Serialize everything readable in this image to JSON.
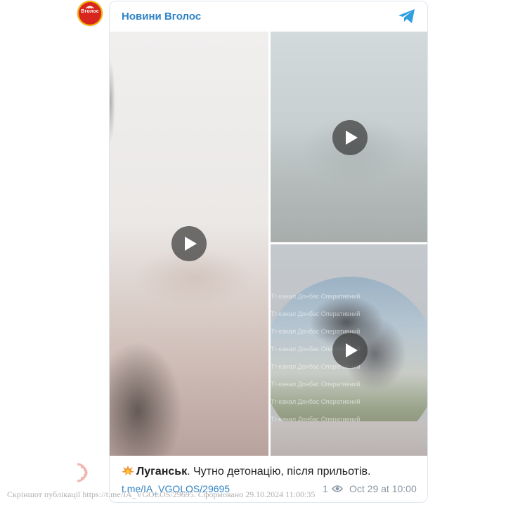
{
  "channel": {
    "name": "Новини Вголос",
    "avatar_text": "Вголос"
  },
  "media": {
    "watermark": "Тг-канал Донбас Оперативний"
  },
  "post": {
    "city": "Луганськ",
    "text": ". Чутно детонацію, після прильотів.",
    "link": "t.me/IA_VGOLOS/29695",
    "views": "1",
    "date": "Oct 29 at 10:00"
  },
  "footer": {
    "text": "Скріншот публікації https://t.me/IA_VGOLOS/29695. Сформовано 29.10.2024 11:00:35"
  },
  "colors": {
    "accent": "#2f83c6",
    "muted": "#8a96a3"
  },
  "icons": [
    "telegram-icon",
    "play-icon",
    "explosion-emoji-icon",
    "eye-icon",
    "vgolos-logo-icon"
  ]
}
